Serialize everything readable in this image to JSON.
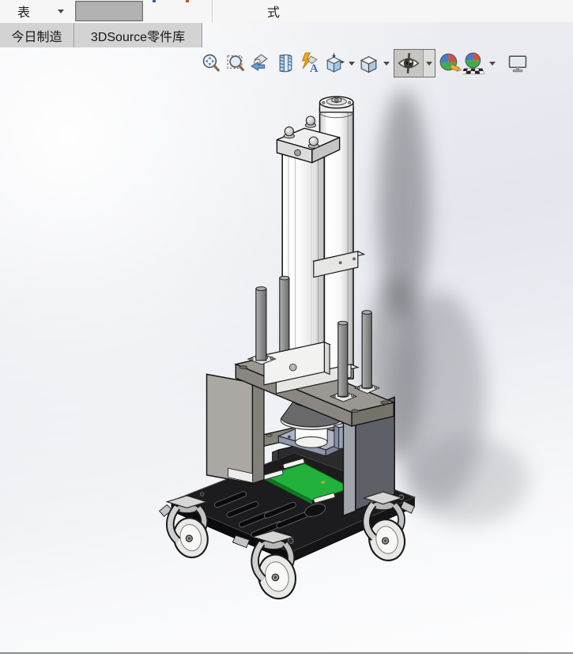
{
  "ribbon": {
    "table_button": "表",
    "style_label": "式"
  },
  "tabs": [
    {
      "label": "今日制造"
    },
    {
      "label": "3DSource零件库"
    }
  ],
  "view_toolbar": {
    "buttons": [
      {
        "name": "zoom-to-fit",
        "has_dropdown": false,
        "pressed": false
      },
      {
        "name": "zoom-to-area",
        "has_dropdown": false,
        "pressed": false
      },
      {
        "name": "previous-view",
        "has_dropdown": false,
        "pressed": false
      },
      {
        "name": "section-view",
        "has_dropdown": false,
        "pressed": false
      },
      {
        "name": "dynamic-annotation-views",
        "has_dropdown": false,
        "pressed": false
      },
      {
        "name": "view-orientation",
        "has_dropdown": true,
        "pressed": false
      },
      {
        "name": "display-style",
        "has_dropdown": true,
        "pressed": false
      },
      {
        "name": "hide-show-items",
        "has_dropdown": true,
        "pressed": true
      },
      {
        "name": "edit-appearance",
        "has_dropdown": false,
        "pressed": false
      },
      {
        "name": "apply-scene",
        "has_dropdown": true,
        "pressed": false
      },
      {
        "name": "view-settings",
        "has_dropdown": false,
        "pressed": false
      }
    ]
  },
  "model": {
    "parts": [
      "pneumatic-press-cylinder",
      "air-tank-cylinder",
      "guide-rods",
      "top-plate",
      "press-head",
      "fixture-plate",
      "frame-walls",
      "pcb-workpiece",
      "trolley-base-plate",
      "swivel-casters"
    ]
  },
  "colors": {
    "pcb_green": "#22b23c",
    "base_black": "#1c1c1e",
    "frame_gray": "#aba8a3",
    "wall_dark": "#5e6068",
    "plate_gray": "#9b9893",
    "fixture_blue_gray": "#aeb4c4",
    "tab_bg": "#d3d3d3",
    "pressed_button_bg": "#c7c5c2",
    "ribbon_bg": "#f6f6f7"
  }
}
